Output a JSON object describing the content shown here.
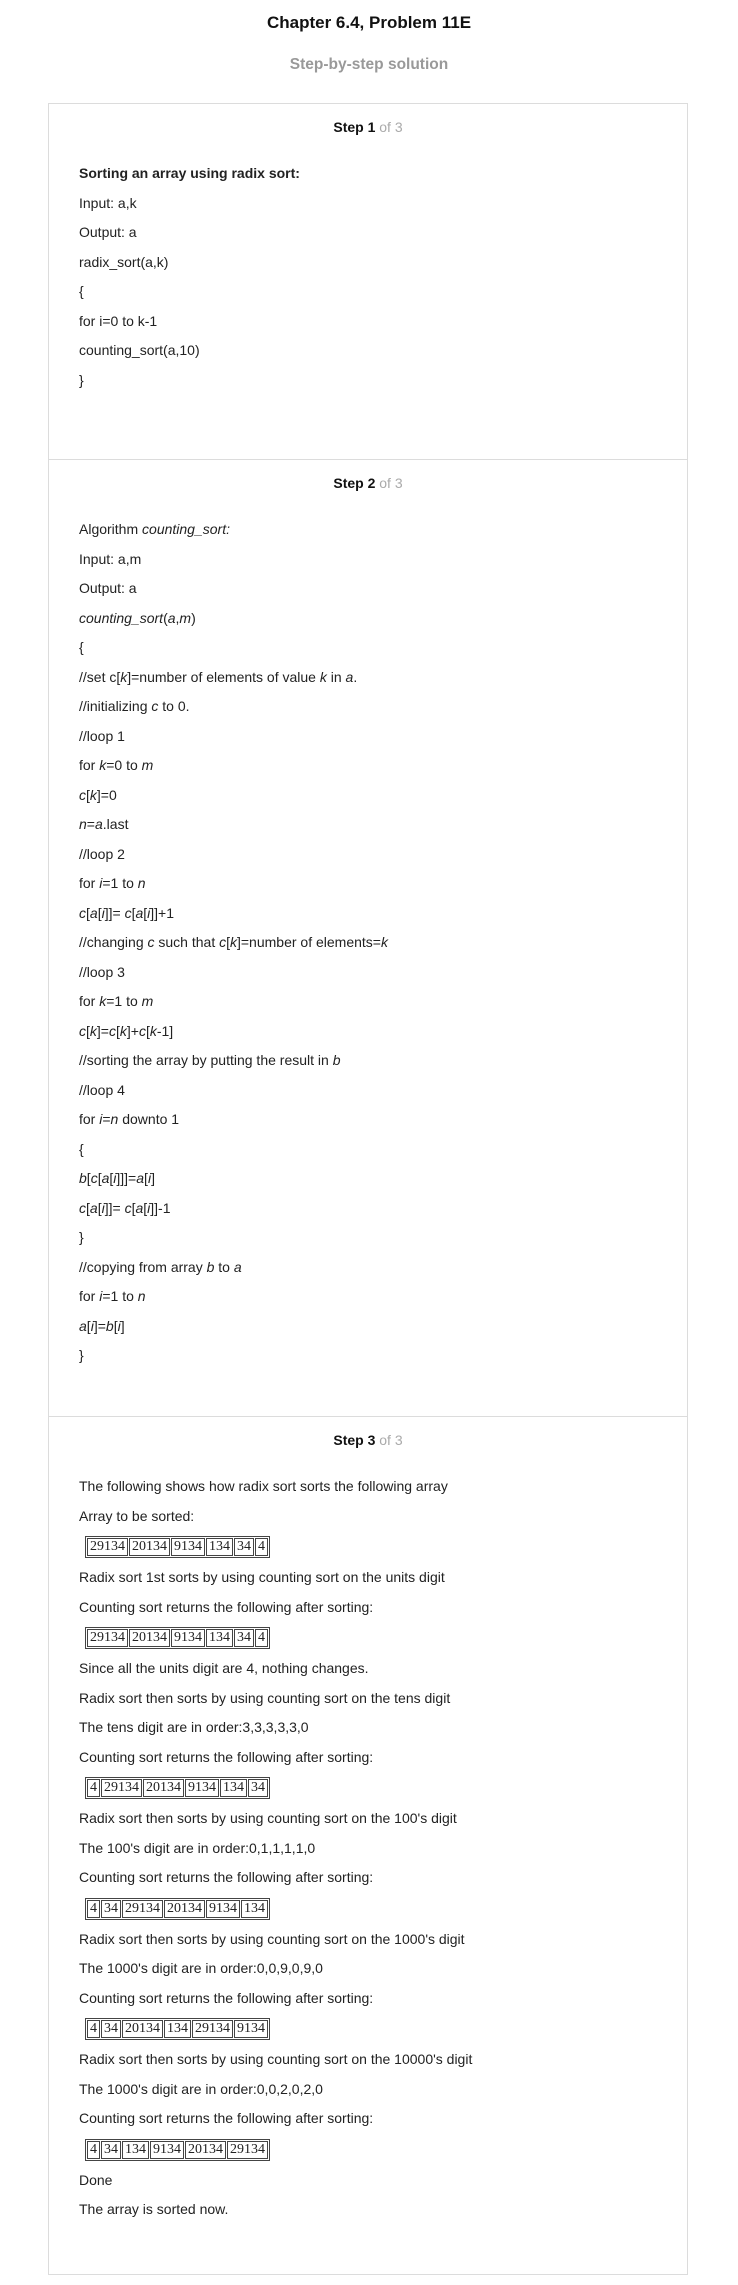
{
  "header": {
    "title": "Chapter 6.4, Problem 11E",
    "subtitle": "Step-by-step solution"
  },
  "step_of": "of 3",
  "steps": {
    "s1": {
      "label": "Step 1",
      "lines": {
        "l0": "Sorting an array using radix sort:",
        "l1": "Input: a,k",
        "l2": "Output: a",
        "l3": "radix_sort(a,k)",
        "l4": "{",
        "l5": "for i=0 to k-1",
        "l6": "counting_sort(a,10)",
        "l7": "}"
      }
    },
    "s2": {
      "label": "Step 2",
      "t": {
        "algorithm": "Algorithm ",
        "counting_sort": "counting_sort:",
        "input": "Input: a,m",
        "output": "Output: a",
        "counting_sort_call": "counting_sort",
        "a": "a",
        "comma": ",",
        "m": "m",
        "open_paren": "(",
        "close_paren": ")",
        "open_brace": "{",
        "close_brace": "}",
        "set_c": "//set c[",
        "k": "k",
        "eq_number": "]=number of elements of value ",
        "in": " in ",
        "period": ".",
        "initializing": "//initializing ",
        "c": "c",
        "to_zero": " to 0.",
        "loop1": "//loop 1",
        "for": "for ",
        "eq_zero_to": "=0 to ",
        "c_open": "c[",
        "close_eq_zero": "]=0",
        "n": "n",
        "eq": "=",
        "dot_last": ".last",
        "loop2": "//loop 2",
        "i": "i",
        "eq_one_to": "=1 to ",
        "open_bracket": "[",
        "close_bracket": "]",
        "close_close": "]]",
        "eq_space": "= ",
        "plus_one": "+1",
        "changing": "//changing ",
        "such_that": " such that ",
        "number_of_elements": "]=number of elements=",
        "loop3": "//loop 3",
        "close_eq": "]=",
        "plus": "+",
        "minus_one_close": "-1]",
        "sorting_by": "//sorting the array by putting the result in ",
        "loop4": "//loop 4",
        "downto_one": " downto 1",
        "close_close_close_eq": "]]]=",
        "minus_one": "-1",
        "copying_from": "//copying from array ",
        "b": "b",
        "to": " to "
      }
    },
    "s3": {
      "label": "Step 3",
      "lines": {
        "l0": "The following shows how radix sort sorts the following array",
        "l1": "Array to be sorted:",
        "l2": "Radix sort 1st sorts by using counting sort on the units digit",
        "l3": "Counting sort returns the following after sorting:",
        "l4": "Since all the units digit are 4, nothing changes.",
        "l5": "Radix sort then sorts by using counting sort on the tens digit",
        "l6": "The tens digit are in order:3,3,3,3,3,0",
        "l7": "Counting sort returns the following after sorting:",
        "l8": "Radix sort then sorts by using counting sort on the 100's digit",
        "l9": "The 100's digit are in order:0,1,1,1,1,0",
        "l10": "Counting sort returns the following after sorting:",
        "l11": "Radix sort then sorts by using counting sort on the 1000's digit",
        "l12": "The 1000's digit are in order:0,0,9,0,9,0",
        "l13": "Counting sort returns the following after sorting:",
        "l14": "Radix sort then sorts by using counting sort on the 10000's digit",
        "l15": "The 1000's digit are in order:0,0,2,0,2,0",
        "l16": "Counting sort returns the following after sorting:",
        "l17": "Done",
        "l18": "The array is sorted now."
      },
      "arrays": {
        "a0": [
          "29134",
          "20134",
          "9134",
          "134",
          "34",
          "4"
        ],
        "a1": [
          "29134",
          "20134",
          "9134",
          "134",
          "34",
          "4"
        ],
        "a2": [
          "4",
          "29134",
          "20134",
          "9134",
          "134",
          "34"
        ],
        "a3": [
          "4",
          "34",
          "29134",
          "20134",
          "9134",
          "134"
        ],
        "a4": [
          "4",
          "34",
          "20134",
          "134",
          "29134",
          "9134"
        ],
        "a5": [
          "4",
          "34",
          "134",
          "9134",
          "20134",
          "29134"
        ]
      }
    }
  }
}
